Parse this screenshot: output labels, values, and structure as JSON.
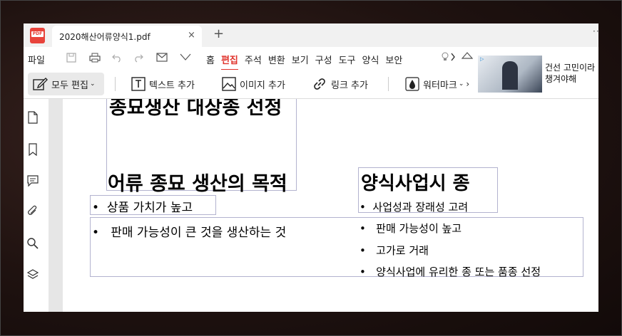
{
  "tab": {
    "title": "2020해산어류양식1.pdf",
    "close": "×",
    "new": "+"
  },
  "app_icon_label": "PDF",
  "menu": {
    "file": "파일",
    "items": [
      "홈",
      "편집",
      "주석",
      "변환",
      "보기",
      "구성",
      "도구",
      "양식",
      "보안"
    ],
    "active": "편집"
  },
  "toolbar": {
    "edit_all": "모두 편집",
    "add_text": "텍스트 추가",
    "add_image": "이미지 추가",
    "add_link": "링크 추가",
    "watermark": "워터마크"
  },
  "ad": {
    "label": "▷",
    "text_line1": "건선 고민이라",
    "text_line2": "챙겨야해"
  },
  "document": {
    "cut_heading": "종묘생산 대상종 선정",
    "heading_left": "어류 종묘 생산의 목적",
    "heading_right": "양식사업시 종",
    "bullet_left_1": "상품 가치가 높고",
    "bullet_left_2": "판매 가능성이 큰 것을 생산하는 것",
    "bullet_right_1": "사업성과 장래성 고려",
    "bullet_right_2": "판매 가능성이 높고",
    "bullet_right_3": "고가로 거래",
    "bullet_right_4": "양식사업에 유리한 종 또는 품종 선정",
    "bullet_char": "•"
  },
  "sidebar_icons": [
    "page-icon",
    "bookmark-icon",
    "comment-icon",
    "attachment-icon",
    "search-icon",
    "layers-icon"
  ],
  "colors": {
    "accent": "#e0322b",
    "box_border": "#b3b3cf"
  }
}
